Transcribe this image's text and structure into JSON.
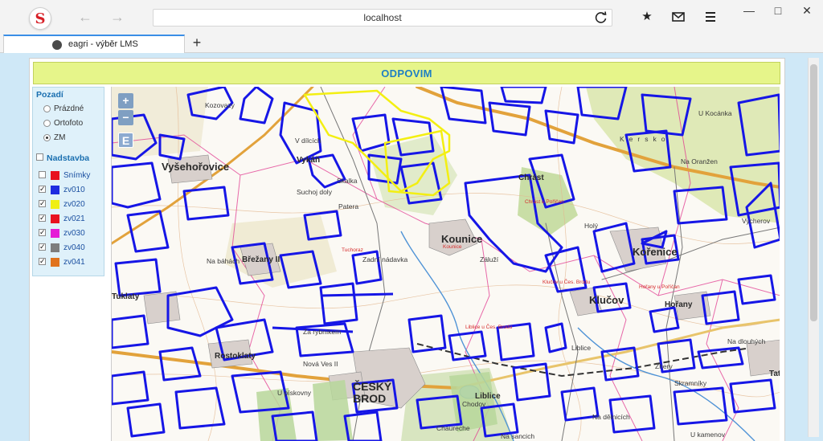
{
  "browser": {
    "url": "localhost",
    "tab_title": "eagri - výběr LMS",
    "new_tab_label": "+",
    "back_icon": "arrow-left-icon",
    "forward_icon": "arrow-right-icon"
  },
  "header": {
    "title": "ODPOVIM"
  },
  "panel": {
    "background_title": "Pozadí",
    "background_options": [
      {
        "label": "Prázdné",
        "selected": false
      },
      {
        "label": "Ortofoto",
        "selected": false
      },
      {
        "label": "ZM",
        "selected": true
      }
    ],
    "overlay_title": "Nadstavba",
    "overlay_checked": false,
    "layers": [
      {
        "label": "Snímky",
        "checked": false,
        "color": "#e8121f"
      },
      {
        "label": "zv010",
        "checked": true,
        "color": "#1f2be0"
      },
      {
        "label": "zv020",
        "checked": true,
        "color": "#f0ef13"
      },
      {
        "label": "zv021",
        "checked": true,
        "color": "#e8121f"
      },
      {
        "label": "zv030",
        "checked": true,
        "color": "#e51bd6"
      },
      {
        "label": "zv040",
        "checked": true,
        "color": "#7d7d7d"
      },
      {
        "label": "zv041",
        "checked": true,
        "color": "#e0731e"
      }
    ]
  },
  "map": {
    "zoom_in": "+",
    "zoom_out": "−",
    "extra_button": "E",
    "place_names": [
      {
        "text": "Vyšehořovice",
        "cls": "big"
      },
      {
        "text": "Vykáň",
        "cls": ""
      },
      {
        "text": "Kounice",
        "cls": "big"
      },
      {
        "text": "Chrást",
        "cls": ""
      },
      {
        "text": "Kořenice",
        "cls": "big"
      },
      {
        "text": "Klučov",
        "cls": "big"
      },
      {
        "text": "Hořany",
        "cls": ""
      },
      {
        "text": "Břežany II",
        "cls": ""
      },
      {
        "text": "Tuklaty",
        "cls": ""
      },
      {
        "text": "Rostoklaty",
        "cls": ""
      },
      {
        "text": "Nová Ves II",
        "cls": "sm"
      },
      {
        "text": "ČESKÝ BROD",
        "cls": "big"
      },
      {
        "text": "Liblice",
        "cls": ""
      },
      {
        "text": "Skramníky",
        "cls": "sm"
      },
      {
        "text": "Žhery",
        "cls": "sm"
      },
      {
        "text": "Tatce",
        "cls": ""
      },
      {
        "text": "V dílcích",
        "cls": "sm"
      },
      {
        "text": "Suchoj doly",
        "cls": "sm"
      },
      {
        "text": "Patera",
        "cls": "sm"
      },
      {
        "text": "Skalka",
        "cls": "sm"
      },
      {
        "text": "Zadní nádavka",
        "cls": "sm"
      },
      {
        "text": "Záluží",
        "cls": "sm"
      },
      {
        "text": "Holý",
        "cls": "sm"
      },
      {
        "text": "U Kocánka",
        "cls": "sm"
      },
      {
        "text": "Na Oranžen",
        "cls": "sm"
      },
      {
        "text": "Vycherov",
        "cls": "sm"
      },
      {
        "text": "Na báhách",
        "cls": "sm"
      },
      {
        "text": "Za rybníkem",
        "cls": "sm"
      },
      {
        "text": "U pískovny",
        "cls": "sm"
      },
      {
        "text": "Na dlouhých",
        "cls": "sm"
      },
      {
        "text": "U kamenov",
        "cls": "sm"
      },
      {
        "text": "Kersko",
        "cls": "sm"
      },
      {
        "text": "Kozovazy",
        "cls": "sm"
      },
      {
        "text": "Chodov",
        "cls": "sm"
      },
      {
        "text": "Chaureche",
        "cls": "sm"
      },
      {
        "text": "Na sancich",
        "cls": "sm"
      },
      {
        "text": "Na dělnicích",
        "cls": "sm"
      },
      {
        "text": "Liblice",
        "cls": "sm"
      },
      {
        "text": "Klučov u Čes. Brodu",
        "cls": "red"
      },
      {
        "text": "Chrást u Poříčan",
        "cls": "red"
      },
      {
        "text": "Kounice",
        "cls": "red"
      },
      {
        "text": "Tuchoraz",
        "cls": "red"
      },
      {
        "text": "Hořany u Poříčan",
        "cls": "red"
      },
      {
        "text": "Liblice u Čes. Brodu",
        "cls": "red"
      }
    ]
  }
}
